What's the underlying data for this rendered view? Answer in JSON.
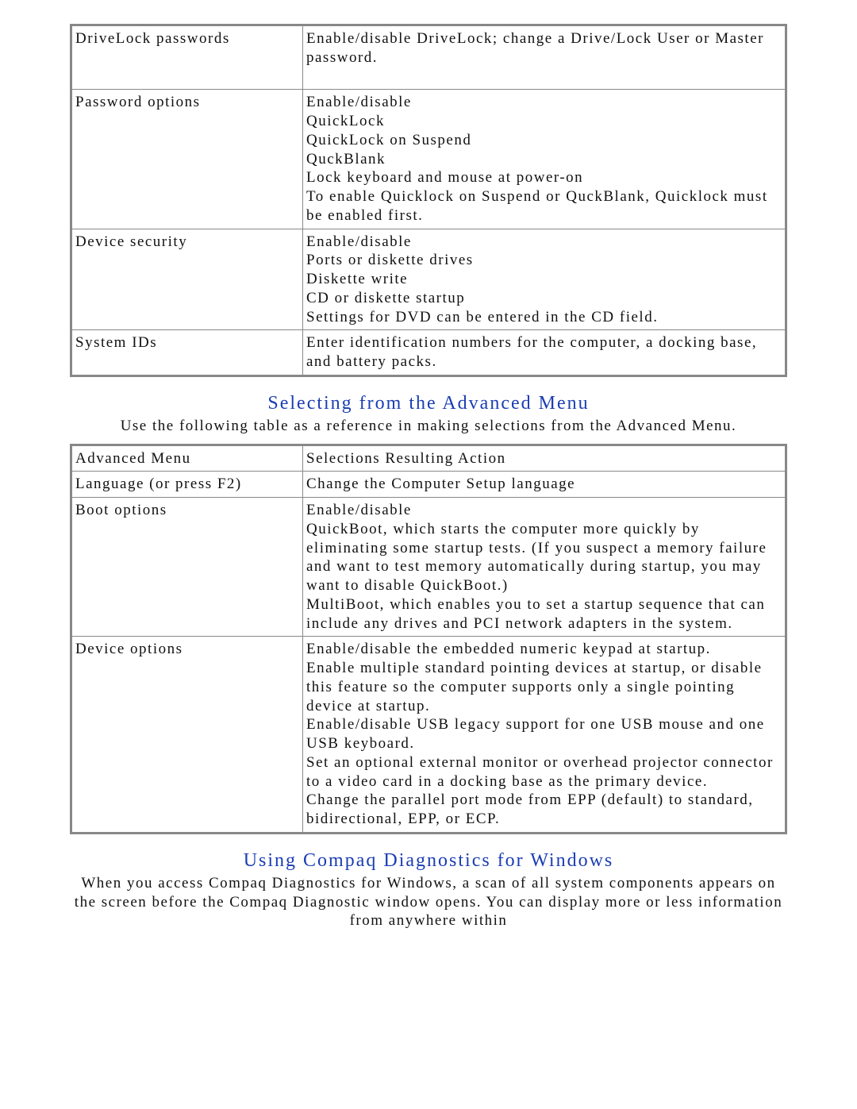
{
  "security_table": {
    "rows": [
      {
        "left": "DriveLock passwords",
        "right": "Enable/disable DriveLock; change a Drive/Lock User or Master password.\n "
      },
      {
        "left": "Password options",
        "right": "Enable/disable\nQuickLock\nQuickLock on Suspend\nQuckBlank\nLock keyboard and mouse at power-on\nTo enable Quicklock on Suspend or QuckBlank, Quicklock must be enabled first."
      },
      {
        "left": "Device security",
        "right": "Enable/disable\nPorts or diskette drives\nDiskette write\nCD or diskette startup\nSettings for DVD can be entered in the CD field."
      },
      {
        "left": "System IDs",
        "right": "Enter identification numbers for the computer, a docking base, and battery packs."
      }
    ]
  },
  "advanced_heading": "Selecting from the Advanced Menu",
  "advanced_intro": "Use the following table as a reference in making selections from the Advanced Menu.",
  "advanced_table": {
    "rows": [
      {
        "left": "Advanced Menu",
        "right": "Selections Resulting Action"
      },
      {
        "left": "Language (or press F2)",
        "right": "Change the Computer Setup language"
      },
      {
        "left": "Boot options",
        "right": "Enable/disable\nQuickBoot, which starts the computer more quickly by eliminating some startup tests. (If you suspect a memory failure and want to test memory automatically during startup, you may want to disable QuickBoot.)\nMultiBoot, which enables you to set a startup sequence that can include any drives and PCI network adapters in the system."
      },
      {
        "left": "Device options",
        "right": "Enable/disable the embedded numeric keypad at startup.\nEnable multiple standard pointing devices at startup, or disable this feature so the computer supports only a single pointing device at startup.\nEnable/disable USB legacy support for one USB mouse and one USB keyboard.\nSet an optional external monitor or overhead projector connector to a video card in a docking base as the primary device.\nChange the parallel port mode from EPP (default) to standard, bidirectional, EPP, or ECP."
      }
    ]
  },
  "diag_heading": "Using Compaq Diagnostics for Windows",
  "diag_intro": "When you access Compaq Diagnostics for Windows, a scan of all system components appears on the screen before the Compaq Diagnostic window opens. You can display more or less information from anywhere within"
}
